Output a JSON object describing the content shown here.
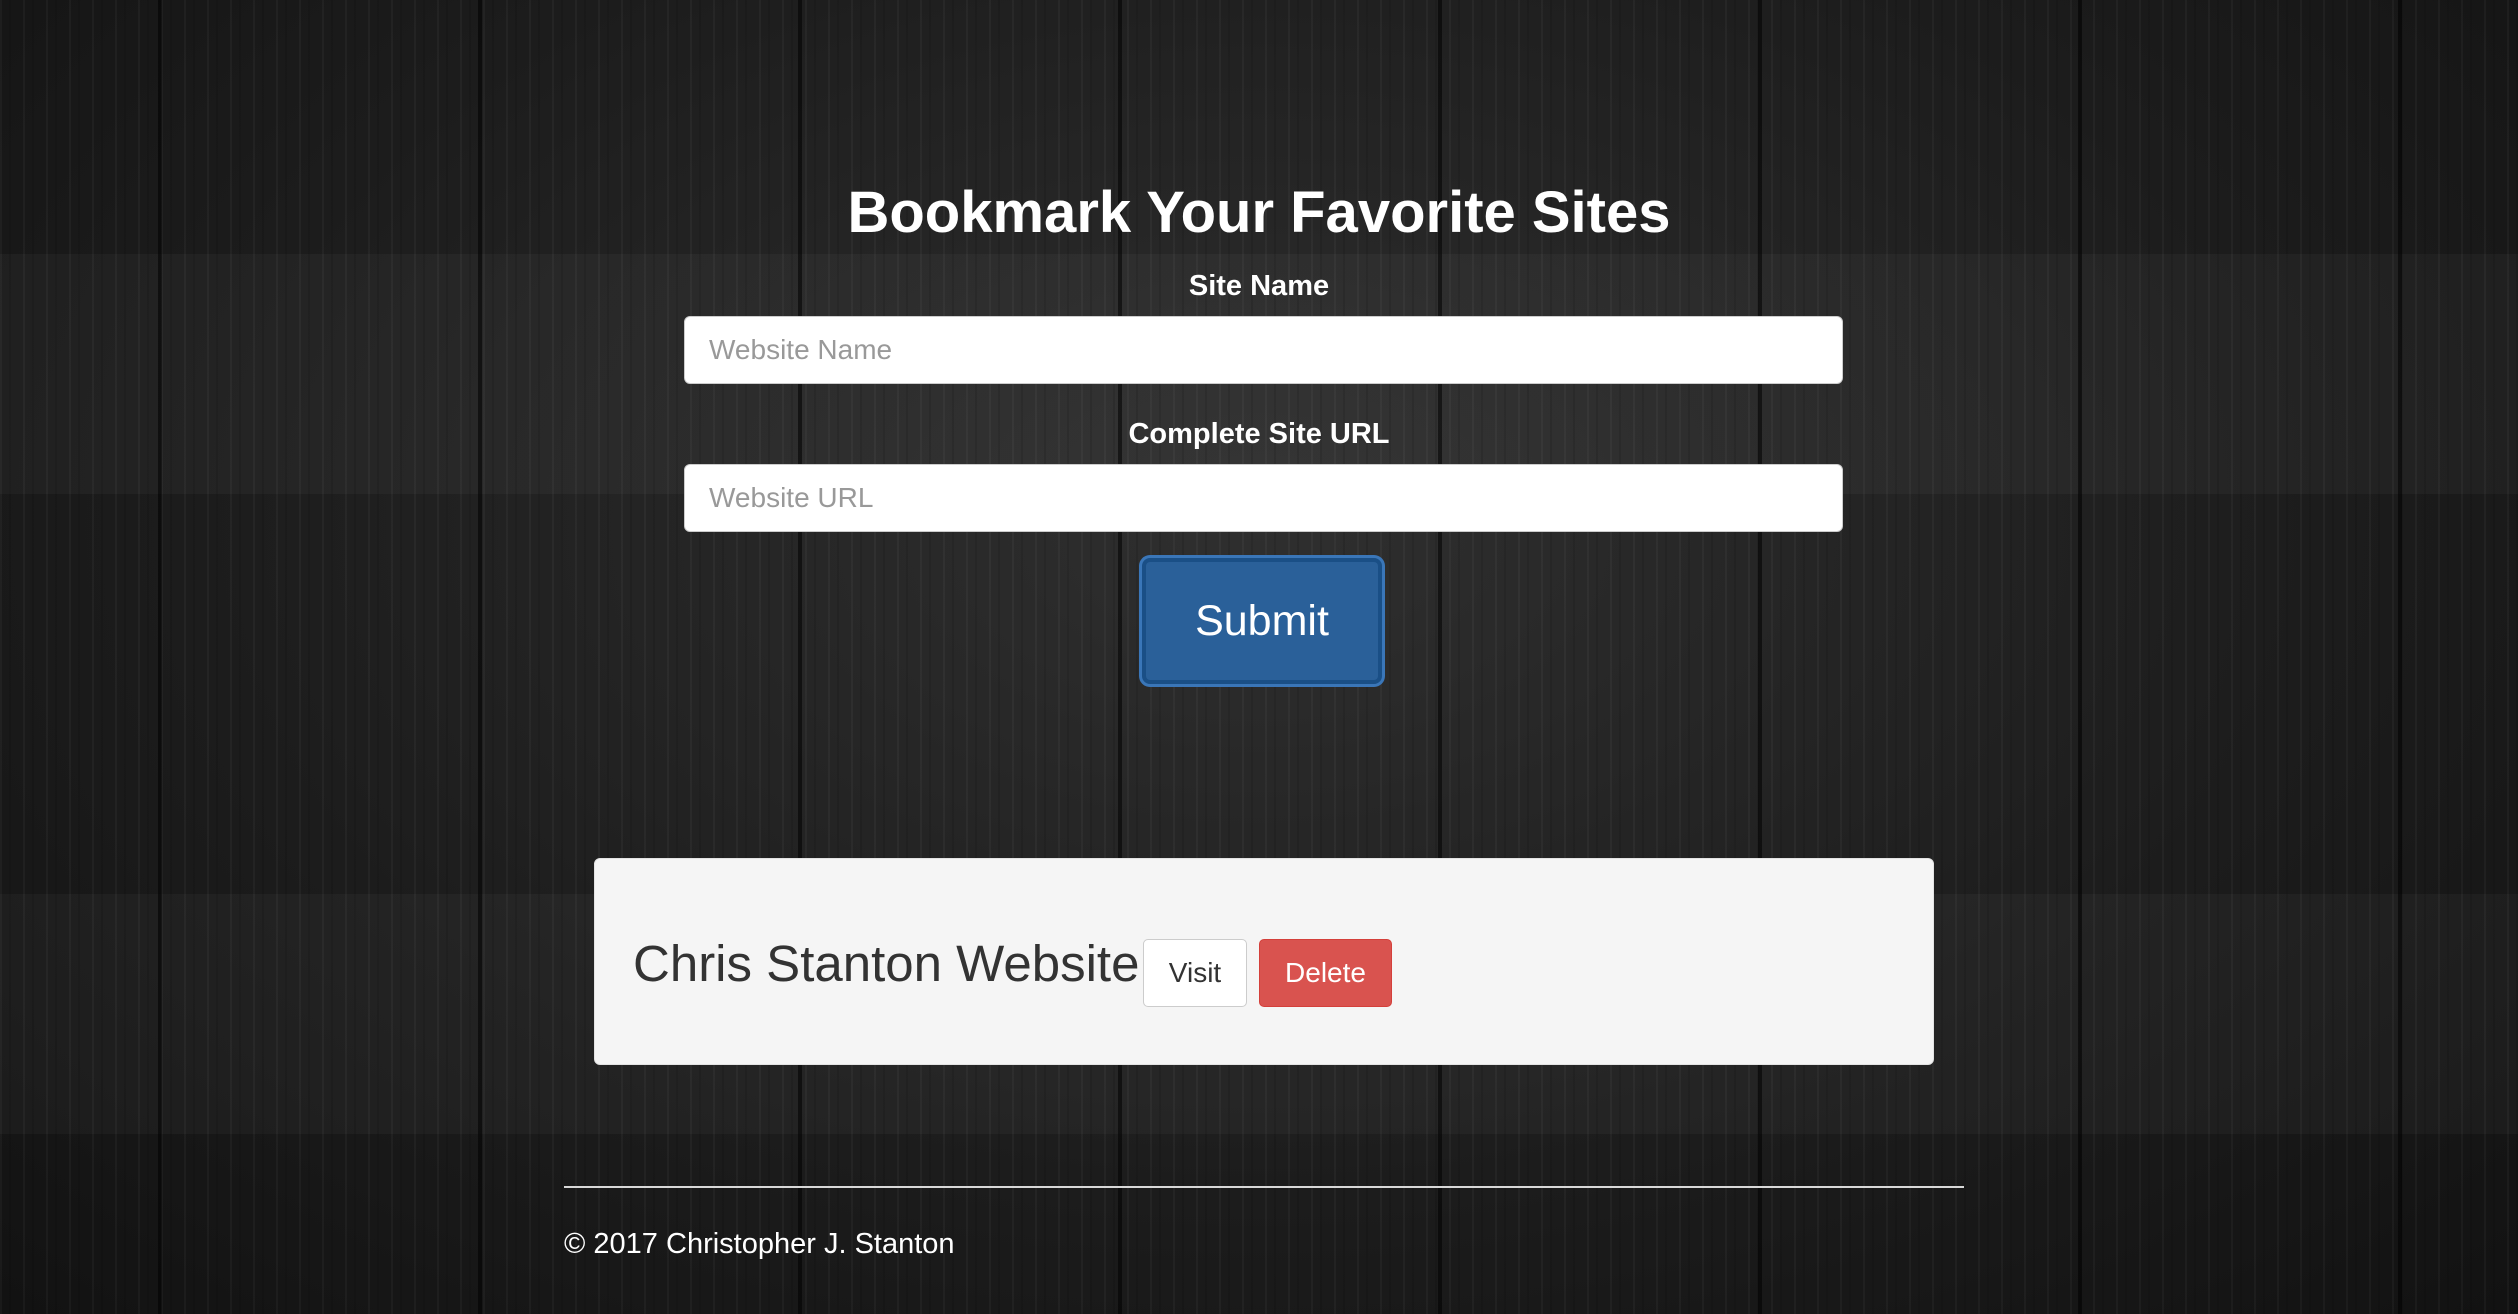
{
  "header": {
    "title": "Bookmark Your Favorite Sites"
  },
  "form": {
    "site_name_label": "Site Name",
    "site_name_placeholder": "Website Name",
    "site_name_value": "",
    "site_url_label": "Complete Site URL",
    "site_url_placeholder": "Website URL",
    "site_url_value": "",
    "submit_label": "Submit"
  },
  "bookmarks": [
    {
      "name": "Chris Stanton Website",
      "visit_label": "Visit",
      "delete_label": "Delete"
    }
  ],
  "footer": {
    "copyright": "© 2017 Christopher J. Stanton"
  },
  "colors": {
    "primary": "#2a6099",
    "danger": "#d9534f",
    "well_background": "#f5f5f5"
  }
}
